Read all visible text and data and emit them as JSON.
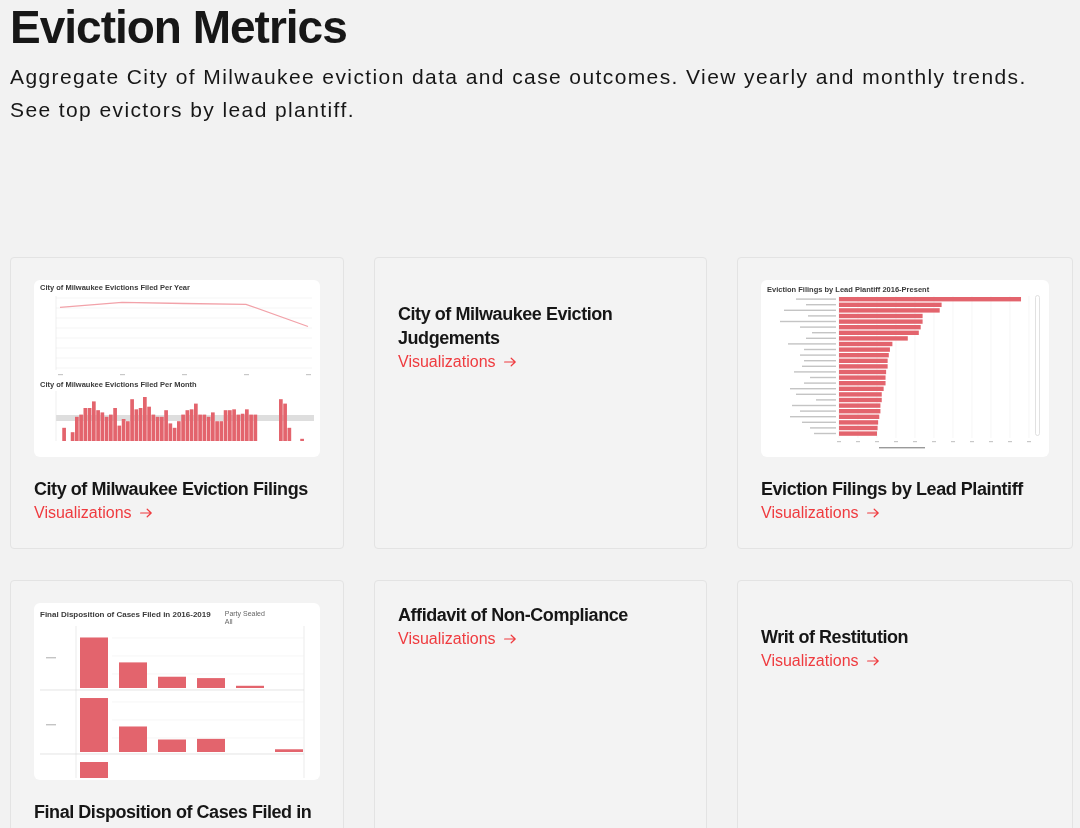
{
  "page": {
    "title": "Eviction Metrics",
    "description": "Aggregate City of Milwaukee eviction data and case outcomes. View yearly and monthly trends. See top evictors by lead plantiff."
  },
  "cards": [
    {
      "title": "City of Milwaukee Eviction Filings",
      "link": "Visualizations",
      "thumbnail": {
        "kind": "line-and-bars",
        "titles": [
          "City of Milwaukee Evictions Filed Per Year",
          "City of Milwaukee Evictions Filed Per Month"
        ]
      }
    },
    {
      "title": "City of Milwaukee Eviction Judgements",
      "link": "Visualizations"
    },
    {
      "title": "Eviction Filings by Lead Plaintiff",
      "link": "Visualizations",
      "thumbnail": {
        "kind": "horizontal-bars",
        "titles": [
          "Eviction Filings by Lead Plantiff 2016-Present"
        ]
      }
    },
    {
      "title": "Final Disposition of Cases Filed in",
      "thumbnail": {
        "kind": "grouped-bars",
        "titles": [
          "Final Disposition of Cases Filed in 2016-2019"
        ],
        "filter_label": "Party Sealed",
        "filter_value": "All"
      }
    },
    {
      "title": "Affidavit of Non-Compliance",
      "link": "Visualizations"
    },
    {
      "title": "Writ of Restitution",
      "link": "Visualizations"
    }
  ]
}
